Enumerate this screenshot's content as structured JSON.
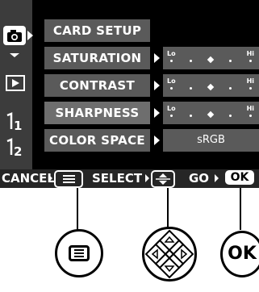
{
  "menu": {
    "items": [
      {
        "label": "CARD SETUP",
        "value_type": "none"
      },
      {
        "label": "SATURATION",
        "value_type": "scale",
        "scale": {
          "lo": "Lo",
          "hi": "Hi"
        },
        "level": 0.5
      },
      {
        "label": "CONTRAST",
        "value_type": "scale",
        "scale": {
          "lo": "Lo",
          "hi": "Hi"
        },
        "level": 0.5
      },
      {
        "label": "SHARPNESS",
        "value_type": "scale",
        "scale": {
          "lo": "Lo",
          "hi": "Hi"
        },
        "level": 0.5
      },
      {
        "label": "COLOR SPACE",
        "value_type": "text",
        "value": "sRGB"
      }
    ]
  },
  "tabs": [
    {
      "icon": "camera-icon"
    },
    {
      "icon": "playback-icon"
    },
    {
      "label": "1",
      "icon": "setup-1-icon"
    },
    {
      "label": "2",
      "icon": "setup-2-icon"
    }
  ],
  "bottom_bar": {
    "cancel": "CANCEL",
    "select": "SELECT",
    "go": "GO",
    "ok": "OK"
  },
  "buttons": {
    "menu": {
      "icon": "menu-icon"
    },
    "arrow_pad": {
      "icon": "arrow-pad-icon"
    },
    "ok": {
      "label": "OK"
    }
  },
  "colors": {
    "screen_bg": "#000000",
    "row_bg": "#5a5a5a",
    "sidebar_bg": "#3c3c3c",
    "text": "#ffffff"
  }
}
